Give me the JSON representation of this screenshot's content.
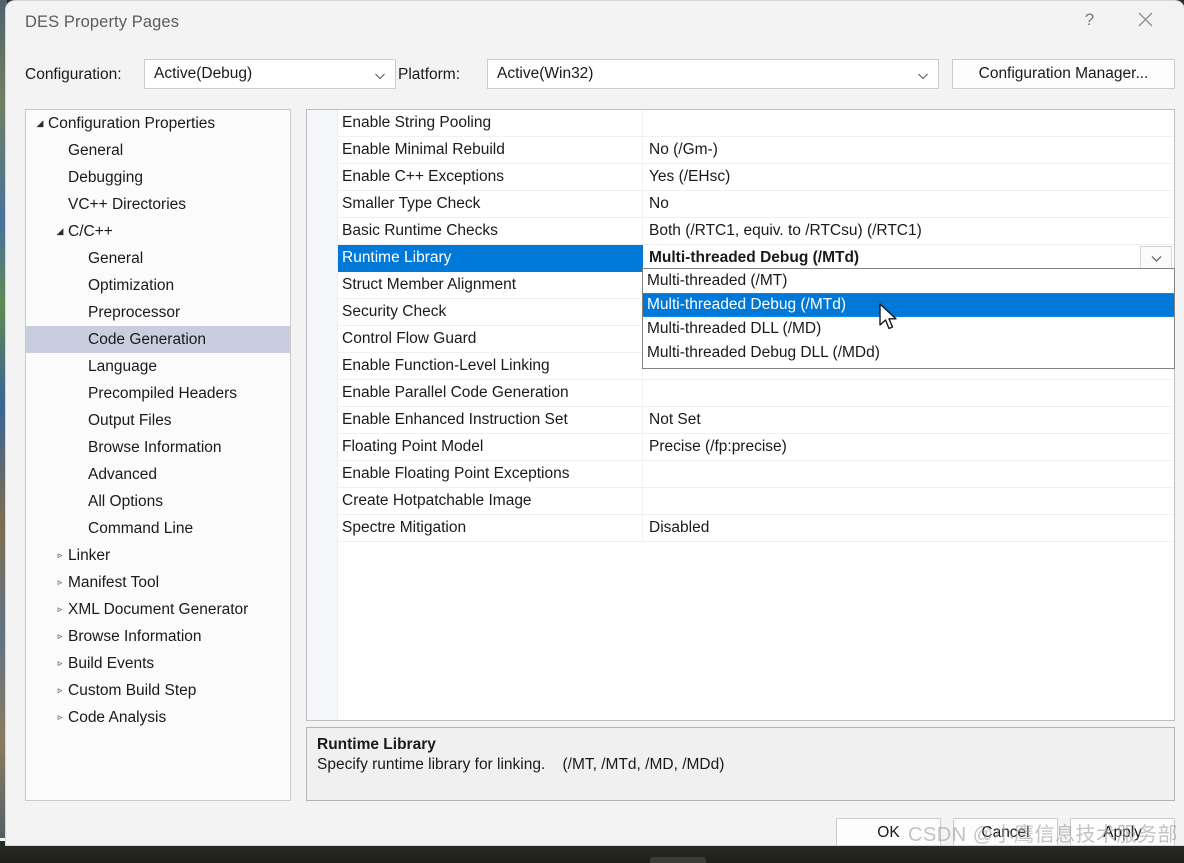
{
  "window": {
    "title": "DES Property Pages",
    "help_glyph": "?",
    "close_glyph": "close-icon"
  },
  "config_bar": {
    "configuration_label": "Configuration:",
    "configuration_value": "Active(Debug)",
    "platform_label": "Platform:",
    "platform_value": "Active(Win32)",
    "configuration_manager_label": "Configuration Manager..."
  },
  "tree": {
    "items": [
      {
        "label": "Configuration Properties",
        "indent": 0,
        "arrow": "expanded",
        "selected": false
      },
      {
        "label": "General",
        "indent": 1,
        "arrow": "none",
        "selected": false
      },
      {
        "label": "Debugging",
        "indent": 1,
        "arrow": "none",
        "selected": false
      },
      {
        "label": "VC++ Directories",
        "indent": 1,
        "arrow": "none",
        "selected": false
      },
      {
        "label": "C/C++",
        "indent": 1,
        "arrow": "expanded",
        "selected": false
      },
      {
        "label": "General",
        "indent": 2,
        "arrow": "none",
        "selected": false
      },
      {
        "label": "Optimization",
        "indent": 2,
        "arrow": "none",
        "selected": false
      },
      {
        "label": "Preprocessor",
        "indent": 2,
        "arrow": "none",
        "selected": false
      },
      {
        "label": "Code Generation",
        "indent": 2,
        "arrow": "none",
        "selected": true
      },
      {
        "label": "Language",
        "indent": 2,
        "arrow": "none",
        "selected": false
      },
      {
        "label": "Precompiled Headers",
        "indent": 2,
        "arrow": "none",
        "selected": false
      },
      {
        "label": "Output Files",
        "indent": 2,
        "arrow": "none",
        "selected": false
      },
      {
        "label": "Browse Information",
        "indent": 2,
        "arrow": "none",
        "selected": false
      },
      {
        "label": "Advanced",
        "indent": 2,
        "arrow": "none",
        "selected": false
      },
      {
        "label": "All Options",
        "indent": 2,
        "arrow": "none",
        "selected": false
      },
      {
        "label": "Command Line",
        "indent": 2,
        "arrow": "none",
        "selected": false
      },
      {
        "label": "Linker",
        "indent": 1,
        "arrow": "collapsed",
        "selected": false
      },
      {
        "label": "Manifest Tool",
        "indent": 1,
        "arrow": "collapsed",
        "selected": false
      },
      {
        "label": "XML Document Generator",
        "indent": 1,
        "arrow": "collapsed",
        "selected": false
      },
      {
        "label": "Browse Information",
        "indent": 1,
        "arrow": "collapsed",
        "selected": false
      },
      {
        "label": "Build Events",
        "indent": 1,
        "arrow": "collapsed",
        "selected": false
      },
      {
        "label": "Custom Build Step",
        "indent": 1,
        "arrow": "collapsed",
        "selected": false
      },
      {
        "label": "Code Analysis",
        "indent": 1,
        "arrow": "collapsed",
        "selected": false
      }
    ]
  },
  "grid": {
    "rows": [
      {
        "name": "Enable String Pooling",
        "value": "",
        "selected": false
      },
      {
        "name": "Enable Minimal Rebuild",
        "value": "No (/Gm-)",
        "selected": false
      },
      {
        "name": "Enable C++ Exceptions",
        "value": "Yes (/EHsc)",
        "selected": false
      },
      {
        "name": "Smaller Type Check",
        "value": "No",
        "selected": false
      },
      {
        "name": "Basic Runtime Checks",
        "value": "Both (/RTC1, equiv. to /RTCsu) (/RTC1)",
        "selected": false
      },
      {
        "name": "Runtime Library",
        "value": "Multi-threaded Debug (/MTd)",
        "selected": true
      },
      {
        "name": "Struct Member Alignment",
        "value": "",
        "selected": false
      },
      {
        "name": "Security Check",
        "value": "",
        "selected": false
      },
      {
        "name": "Control Flow Guard",
        "value": "",
        "selected": false
      },
      {
        "name": "Enable Function-Level Linking",
        "value": "",
        "selected": false
      },
      {
        "name": "Enable Parallel Code Generation",
        "value": "",
        "selected": false
      },
      {
        "name": "Enable Enhanced Instruction Set",
        "value": "Not Set",
        "selected": false
      },
      {
        "name": "Floating Point Model",
        "value": "Precise (/fp:precise)",
        "selected": false
      },
      {
        "name": "Enable Floating Point Exceptions",
        "value": "",
        "selected": false
      },
      {
        "name": "Create Hotpatchable Image",
        "value": "",
        "selected": false
      },
      {
        "name": "Spectre Mitigation",
        "value": "Disabled",
        "selected": false
      }
    ]
  },
  "dropdown": {
    "options": [
      {
        "label": "Multi-threaded (/MT)",
        "active": false
      },
      {
        "label": "Multi-threaded Debug (/MTd)",
        "active": true
      },
      {
        "label": "Multi-threaded DLL (/MD)",
        "active": false
      },
      {
        "label": "Multi-threaded Debug DLL (/MDd)",
        "active": false
      }
    ]
  },
  "description": {
    "title": "Runtime Library",
    "body": "Specify runtime library for linking.    (/MT, /MTd, /MD, /MDd)"
  },
  "footer": {
    "ok_label": "OK",
    "cancel_label": "Cancel",
    "apply_label": "Apply"
  },
  "watermark": {
    "text": "CSDN @小鹰信息技术服务部"
  },
  "colors": {
    "accent": "#0078d7",
    "tree_selection": "#c8cee0",
    "dialog_bg": "#f3f3f3"
  }
}
